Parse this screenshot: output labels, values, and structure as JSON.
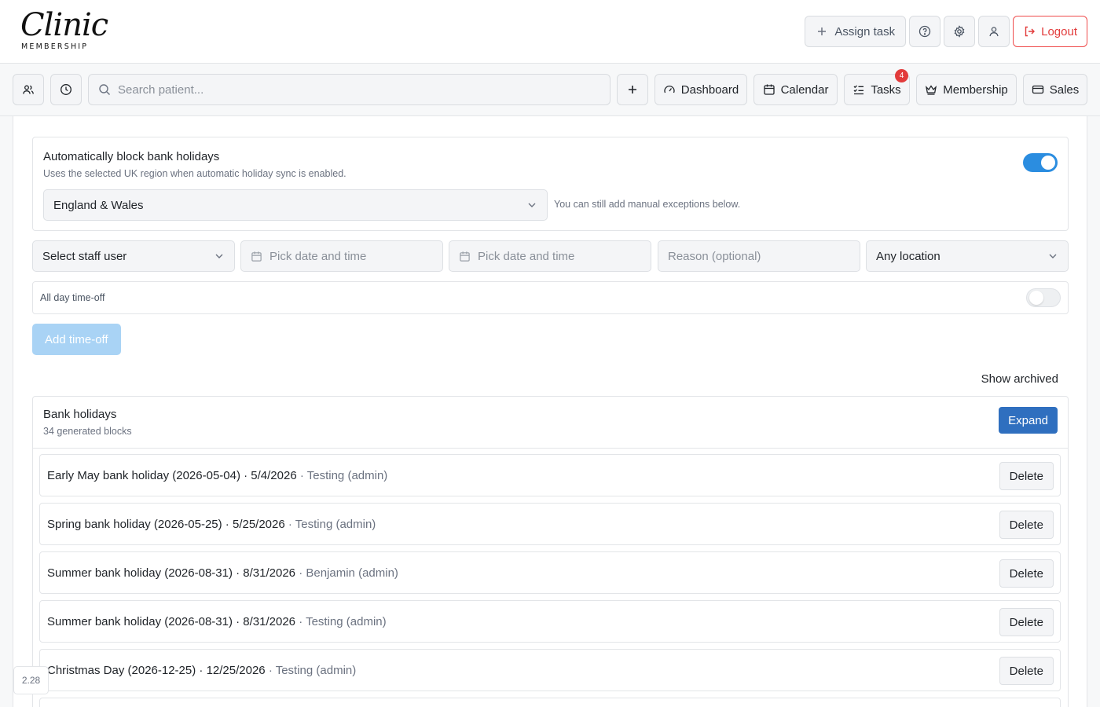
{
  "brand": {
    "name": "Clinic",
    "tagline": "MEMBERSHIP"
  },
  "header": {
    "assign_task": "Assign task",
    "logout": "Logout"
  },
  "nav": {
    "search_placeholder": "Search patient...",
    "dashboard": "Dashboard",
    "calendar": "Calendar",
    "tasks": "Tasks",
    "tasks_badge": "4",
    "membership": "Membership",
    "sales": "Sales"
  },
  "auto_block": {
    "title": "Automatically block bank holidays",
    "description": "Uses the selected UK region when automatic holiday sync is enabled.",
    "enabled": true,
    "region": "England & Wales",
    "hint": "You can still add manual exceptions below."
  },
  "time_off_form": {
    "staff_placeholder": "Select staff user",
    "start_placeholder": "Pick date and time",
    "end_placeholder": "Pick date and time",
    "reason_placeholder": "Reason (optional)",
    "location": "Any location",
    "all_day_label": "All day time-off",
    "all_day": false,
    "add_button": "Add time-off"
  },
  "show_archived": "Show archived",
  "bank_holidays": {
    "title": "Bank holidays",
    "subtitle": "34 generated blocks",
    "expand_button": "Expand",
    "delete_label": "Delete",
    "rows": [
      {
        "label": "Early May bank holiday (2026-05-04) · 5/4/2026",
        "meta": "· Testing (admin)"
      },
      {
        "label": "Spring bank holiday (2026-05-25) · 5/25/2026",
        "meta": "· Testing (admin)"
      },
      {
        "label": "Summer bank holiday (2026-08-31) · 8/31/2026",
        "meta": "· Benjamin (admin)"
      },
      {
        "label": "Summer bank holiday (2026-08-31) · 8/31/2026",
        "meta": "· Testing (admin)"
      },
      {
        "label": "Christmas Day (2026-12-25) · 12/25/2026",
        "meta": "· Testing (admin)"
      }
    ]
  },
  "version": "2.28",
  "colors": {
    "accent": "#2b8de0",
    "danger": "#e23b3b",
    "primary_button": "#2f6fbf"
  }
}
